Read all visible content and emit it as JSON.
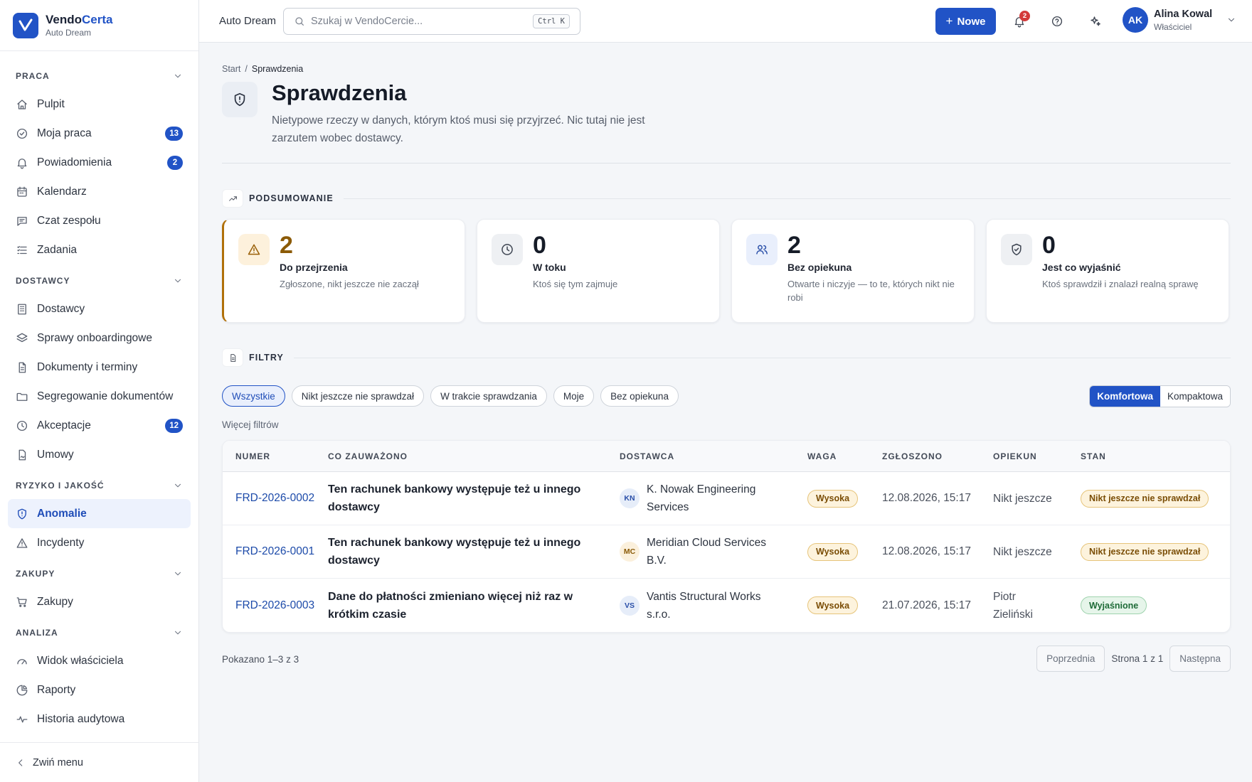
{
  "brand": {
    "name_part1": "Vendo",
    "name_part2": "Certa",
    "org": "Auto Dream"
  },
  "sidebar": {
    "sections": [
      {
        "title": "PRACA",
        "items": [
          {
            "label": "Pulpit",
            "icon": "home-icon"
          },
          {
            "label": "Moja praca",
            "icon": "check-circle-icon",
            "badge": "13"
          },
          {
            "label": "Powiadomienia",
            "icon": "bell-icon",
            "badge": "2"
          },
          {
            "label": "Kalendarz",
            "icon": "calendar-icon"
          },
          {
            "label": "Czat zespołu",
            "icon": "chat-icon"
          },
          {
            "label": "Zadania",
            "icon": "list-icon"
          }
        ]
      },
      {
        "title": "DOSTAWCY",
        "items": [
          {
            "label": "Dostawcy",
            "icon": "building-icon"
          },
          {
            "label": "Sprawy onboardingowe",
            "icon": "layers-icon"
          },
          {
            "label": "Dokumenty i terminy",
            "icon": "document-icon"
          },
          {
            "label": "Segregowanie dokumentów",
            "icon": "folder-icon"
          },
          {
            "label": "Akceptacje",
            "icon": "clock-icon",
            "badge": "12"
          },
          {
            "label": "Umowy",
            "icon": "contract-icon"
          }
        ]
      },
      {
        "title": "RYZYKO I JAKOŚĆ",
        "items": [
          {
            "label": "Anomalie",
            "icon": "shield-icon",
            "active": true
          },
          {
            "label": "Incydenty",
            "icon": "warning-icon"
          }
        ]
      },
      {
        "title": "ZAKUPY",
        "items": [
          {
            "label": "Zakupy",
            "icon": "cart-icon"
          }
        ]
      },
      {
        "title": "ANALIZA",
        "items": [
          {
            "label": "Widok właściciela",
            "icon": "gauge-icon"
          },
          {
            "label": "Raporty",
            "icon": "pie-icon"
          },
          {
            "label": "Historia audytowa",
            "icon": "activity-icon"
          }
        ]
      }
    ],
    "collapse_label": "Zwiń menu"
  },
  "topbar": {
    "org": "Auto Dream",
    "search_placeholder": "Szukaj w VendoCercie...",
    "search_shortcut": "Ctrl K",
    "new_button": "Nowe",
    "notifications_count": "2",
    "user": {
      "initials": "AK",
      "name": "Alina Kowal",
      "role": "Właściciel"
    }
  },
  "breadcrumb": {
    "root": "Start",
    "separator": "/",
    "current": "Sprawdzenia"
  },
  "page": {
    "title": "Sprawdzenia",
    "description": "Nietypowe rzeczy w danych, którym ktoś musi się przyjrzeć. Nic tutaj nie jest zarzutem wobec dostawcy."
  },
  "summary": {
    "heading": "PODSUMOWANIE",
    "cards": [
      {
        "value": "2",
        "label": "Do przejrzenia",
        "desc": "Zgłoszone, nikt jeszcze nie zaczął",
        "icon": "warning-icon",
        "icon_bg": "#fdf1dc",
        "icon_color": "#9a6008"
      },
      {
        "value": "0",
        "label": "W toku",
        "desc": "Ktoś się tym zajmuje",
        "icon": "clock-icon",
        "icon_bg": "#eef0f3",
        "icon_color": "#3e4552"
      },
      {
        "value": "2",
        "label": "Bez opiekuna",
        "desc": "Otwarte i niczyje — to te, których nikt nie robi",
        "icon": "users-icon",
        "icon_bg": "#e9effc",
        "icon_color": "#2a4fa8"
      },
      {
        "value": "0",
        "label": "Jest co wyjaśnić",
        "desc": "Ktoś sprawdził i znalazł realną sprawę",
        "icon": "shield-check-icon",
        "icon_bg": "#eef0f3",
        "icon_color": "#3e4552"
      }
    ]
  },
  "filters": {
    "heading": "FILTRY",
    "chips": [
      "Wszystkie",
      "Nikt jeszcze nie sprawdzał",
      "W trakcie sprawdzania",
      "Moje",
      "Bez opiekuna"
    ],
    "active_chip": "Wszystkie",
    "density": [
      "Komfortowa",
      "Kompaktowa"
    ],
    "density_active": "Komfortowa",
    "more": "Więcej filtrów"
  },
  "table": {
    "headers": [
      "NUMER",
      "CO ZAUWAŻONO",
      "DOSTAWCA",
      "WAGA",
      "ZGŁOSZONO",
      "OPIEKUN",
      "STAN"
    ],
    "rows": [
      {
        "number": "FRD-2026-0002",
        "what": "Ten rachunek bankowy występuje też u innego dostawcy",
        "vendor_initials": "KN",
        "vendor": "K. Nowak Engineering Services",
        "vendor_bg": "#e6edf9",
        "vendor_fg": "#2a4fa8",
        "weight": "Wysoka",
        "reported": "12.08.2026, 15:17",
        "owner": "Nikt jeszcze",
        "status": "Nikt jeszcze nie sprawdzał",
        "status_kind": "open"
      },
      {
        "number": "FRD-2026-0001",
        "what": "Ten rachunek bankowy występuje też u innego dostawcy",
        "vendor_initials": "MC",
        "vendor": "Meridian Cloud Services B.V.",
        "vendor_bg": "#fbf0dc",
        "vendor_fg": "#8a5a07",
        "weight": "Wysoka",
        "reported": "12.08.2026, 15:17",
        "owner": "Nikt jeszcze",
        "status": "Nikt jeszcze nie sprawdzał",
        "status_kind": "open"
      },
      {
        "number": "FRD-2026-0003",
        "what": "Dane do płatności zmieniano więcej niż raz w krótkim czasie",
        "vendor_initials": "VS",
        "vendor": "Vantis Structural Works s.r.o.",
        "vendor_bg": "#e6edf9",
        "vendor_fg": "#2a4fa8",
        "weight": "Wysoka",
        "reported": "21.07.2026, 15:17",
        "owner": "Piotr Zieliński",
        "status": "Wyjaśnione",
        "status_kind": "done"
      }
    ]
  },
  "pagination": {
    "shown": "Pokazano 1–3 z 3",
    "prev": "Poprzednia",
    "page_info": "Strona 1 z 1",
    "next": "Następna"
  }
}
